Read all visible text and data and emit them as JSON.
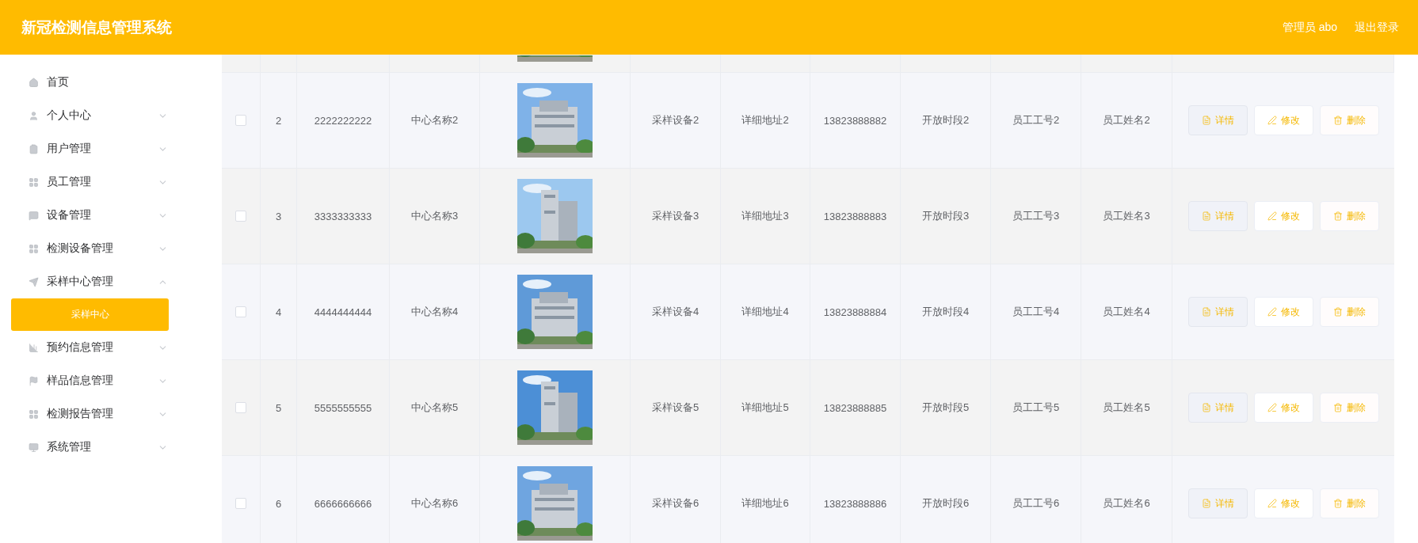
{
  "header": {
    "title": "新冠检测信息管理系统",
    "user": "管理员 abo",
    "logout": "退出登录"
  },
  "sidebar": {
    "items": [
      {
        "label": "首页",
        "kind": "link"
      },
      {
        "label": "个人中心",
        "kind": "submenu",
        "expanded": false
      },
      {
        "label": "用户管理",
        "kind": "submenu",
        "expanded": false
      },
      {
        "label": "员工管理",
        "kind": "submenu",
        "expanded": false
      },
      {
        "label": "设备管理",
        "kind": "submenu",
        "expanded": false
      },
      {
        "label": "检测设备管理",
        "kind": "submenu",
        "expanded": false
      },
      {
        "label": "采样中心管理",
        "kind": "submenu",
        "expanded": true,
        "children": [
          {
            "label": "采样中心",
            "selected": true
          }
        ]
      },
      {
        "label": "预约信息管理",
        "kind": "submenu",
        "expanded": false
      },
      {
        "label": "样品信息管理",
        "kind": "submenu",
        "expanded": false
      },
      {
        "label": "检测报告管理",
        "kind": "submenu",
        "expanded": false
      },
      {
        "label": "系统管理",
        "kind": "submenu",
        "expanded": false
      }
    ]
  },
  "table": {
    "rows": [
      {
        "checked": false,
        "index": "2",
        "number": "2222222222",
        "name": "中心名称2",
        "equipment": "采样设备2",
        "address": "详细地址2",
        "phone": "13823888882",
        "hours": "开放时段2",
        "staff_id": "员工工号2",
        "staff_name": "员工姓名2",
        "actions": [
          "详情",
          "修改",
          "删除"
        ]
      },
      {
        "checked": false,
        "index": "3",
        "number": "3333333333",
        "name": "中心名称3",
        "equipment": "采样设备3",
        "address": "详细地址3",
        "phone": "13823888883",
        "hours": "开放时段3",
        "staff_id": "员工工号3",
        "staff_name": "员工姓名3",
        "actions": [
          "详情",
          "修改",
          "删除"
        ]
      },
      {
        "checked": false,
        "index": "4",
        "number": "4444444444",
        "name": "中心名称4",
        "equipment": "采样设备4",
        "address": "详细地址4",
        "phone": "13823888884",
        "hours": "开放时段4",
        "staff_id": "员工工号4",
        "staff_name": "员工姓名4",
        "actions": [
          "详情",
          "修改",
          "删除"
        ]
      },
      {
        "checked": false,
        "index": "5",
        "number": "5555555555",
        "name": "中心名称5",
        "equipment": "采样设备5",
        "address": "详细地址5",
        "phone": "13823888885",
        "hours": "开放时段5",
        "staff_id": "员工工号5",
        "staff_name": "员工姓名5",
        "actions": [
          "详情",
          "修改",
          "删除"
        ]
      },
      {
        "checked": false,
        "index": "6",
        "number": "6666666666",
        "name": "中心名称6",
        "equipment": "采样设备6",
        "address": "详细地址6",
        "phone": "13823888886",
        "hours": "开放时段6",
        "staff_id": "员工工号6",
        "staff_name": "员工姓名6",
        "actions": [
          "详情",
          "修改",
          "删除"
        ]
      }
    ]
  }
}
